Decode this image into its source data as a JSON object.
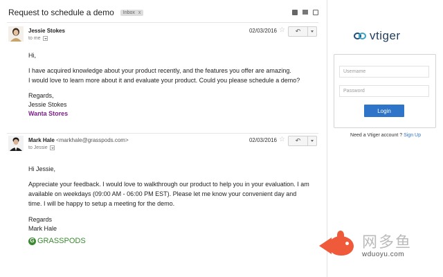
{
  "mail": {
    "subject": "Request to schedule a demo",
    "label": "Inbox",
    "label_remove": "x",
    "toolbar_icons": [
      "print-all-icon",
      "print-icon",
      "popout-icon"
    ]
  },
  "messages": [
    {
      "sender_name": "Jessie Stokes",
      "sender_email": "",
      "to": "to me",
      "date": "02/03/2016",
      "lines": [
        "Hi,",
        "I have acquired knowledge about your product recently, and the features you offer are amazing.",
        "I would love to learn more about it and evaluate your product. Could you please schedule a demo?",
        "Regards,",
        "Jessie Stokes",
        "Wanta Stores"
      ]
    },
    {
      "sender_name": "Mark Hale",
      "sender_email": "<markhale@grasspods.com>",
      "to": "to Jessie",
      "date": "02/03/2016",
      "lines": [
        "Hi Jessie,",
        "Appreciate your feedback. I would love to walkthrough our product to help you in your evaluation. I am",
        "available on weekdays (09:00 AM - 06:00 PM EST). Please let me know your convenient day and",
        "time. I will be happy to setup a meeting for the demo.",
        "Regards",
        "Mark Hale"
      ],
      "company_logo": "GRASSPODS"
    }
  ],
  "vtiger": {
    "logo_text": "vtiger",
    "username_placeholder": "Username",
    "password_placeholder": "Password",
    "login_label": "Login",
    "need_account": "Need a Vtiger account ?",
    "signup_label": "Sign Up"
  },
  "watermark": {
    "chinese": "网多鱼",
    "url": "wduoyu.com"
  },
  "colors": {
    "accent_blue": "#2e74c9",
    "signature_purple": "#7b1e8a",
    "grasspods_green": "#3a8a2f",
    "watermark_orange": "#ee5a3a"
  }
}
